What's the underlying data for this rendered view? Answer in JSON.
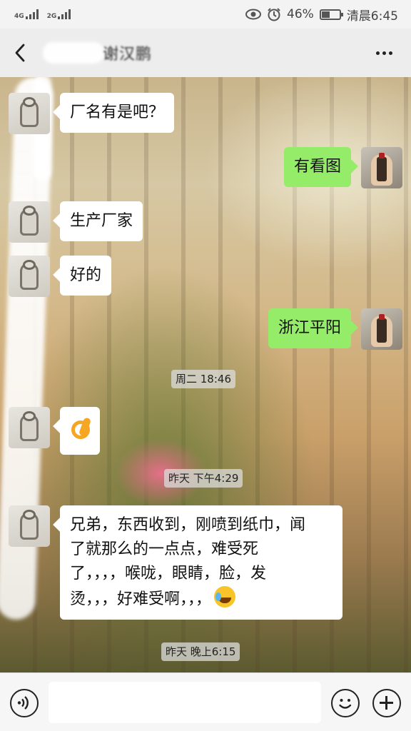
{
  "status_bar": {
    "network_1": "4G",
    "network_2": "2G",
    "battery_percent": "46%",
    "time": "清晨6:45",
    "icons": [
      "eye-icon",
      "alarm-icon",
      "battery-icon"
    ]
  },
  "header": {
    "title": "谢汉鹏",
    "back_icon": "chevron-left-icon",
    "more_icon": "more-dots-icon"
  },
  "messages": [
    {
      "side": "in",
      "text": "厂名有是吧？"
    },
    {
      "side": "out",
      "text": "有看图"
    },
    {
      "side": "in",
      "text": "生产厂家"
    },
    {
      "side": "in",
      "text": "好的"
    },
    {
      "side": "out",
      "text": "浙江平阳"
    },
    {
      "side": "timestamp",
      "text": "周二 18:46"
    },
    {
      "side": "in",
      "text": "",
      "emoji": "ok-hand-emoji"
    },
    {
      "side": "timestamp",
      "text": "昨天 下午4:29"
    },
    {
      "side": "in",
      "lines": [
        "兄弟，东西收到，刚喷到纸巾，闻",
        "了就那么的一点点，难受死",
        "了，，，，喉咙，眼睛，脸，发",
        "烫，，，好难受啊，，，"
      ],
      "emoji": "crying-laughing-emoji"
    },
    {
      "side": "timestamp",
      "text": "昨天 晚上6:15"
    }
  ],
  "input_bar": {
    "placeholder": "",
    "voice_icon": "voice-icon",
    "emoji_icon": "emoji-icon",
    "plus_icon": "plus-icon"
  },
  "colors": {
    "outgoing_bubble": "#95ec69",
    "incoming_bubble": "#ffffff",
    "header_bg": "#ededed"
  }
}
